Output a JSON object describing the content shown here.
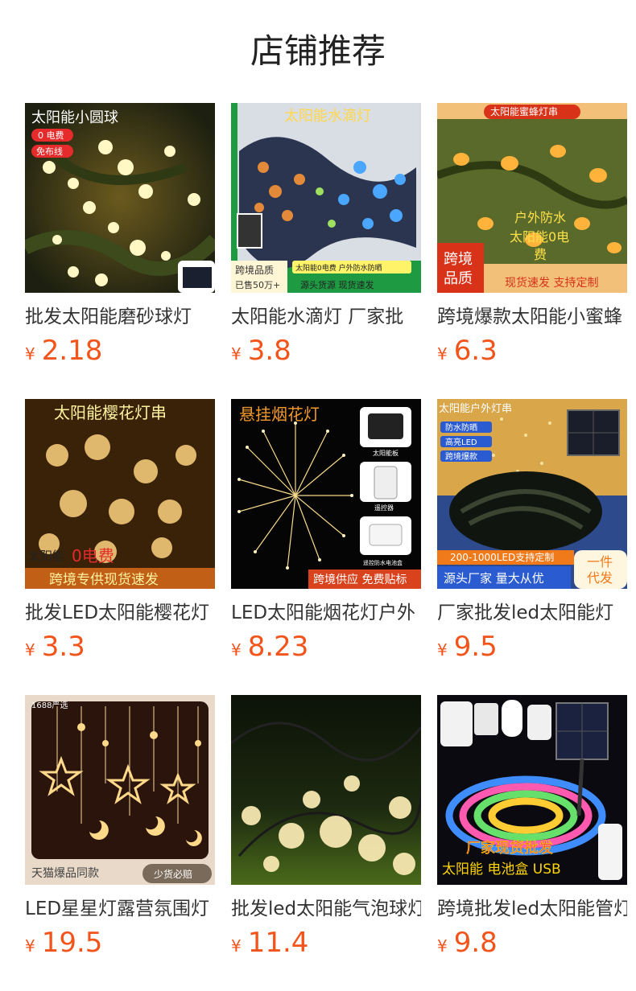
{
  "section": {
    "title": "店铺推荐"
  },
  "currency": "¥",
  "products": [
    {
      "name": "批发太阳能磨砂球灯",
      "price": "2.18",
      "image_text": {
        "headline": "太阳能小圆球",
        "tag1": "0 电费",
        "tag2": "免布线"
      }
    },
    {
      "name": "太阳能水滴灯 厂家批",
      "price": "3.8",
      "image_text": {
        "headline": "太阳能水滴灯",
        "left1": "跨境品质",
        "left2": "已售50万+",
        "right1": "太阳能0电费 户外防水防晒",
        "right2": "源头货源  现货速发"
      }
    },
    {
      "name": "跨境爆款太阳能小蜜蜂",
      "price": "6.3",
      "image_text": {
        "headline": "太阳能蜜蜂灯串",
        "mid1": "户外防水",
        "mid2": "太阳能0电",
        "mid3": "费",
        "badge": "跨境 品质",
        "bottom": "现货速发 支持定制"
      }
    },
    {
      "name": "批发LED太阳能樱花灯",
      "price": "3.3",
      "image_text": {
        "headline": "太阳能樱花灯串",
        "tag": "0电费",
        "bottom": "跨境专供现货速发"
      }
    },
    {
      "name": "LED太阳能烟花灯户外",
      "price": "8.23",
      "image_text": {
        "headline": "悬挂烟花灯",
        "c1": "太阳能板",
        "c2": "遥控器",
        "c3": "遥控防水电池盒",
        "bottom": "跨境供应 免费贴标"
      }
    },
    {
      "name": "厂家批发led太阳能灯",
      "price": "9.5",
      "image_text": {
        "headline": "太阳能户外灯串",
        "f1": "防水防晒",
        "f2": "高亮LED",
        "f3": "跨境爆款",
        "band": "200-1000LED支持定制",
        "bottom": "源头厂家 量大从优",
        "side": "一件代发"
      }
    },
    {
      "name": "LED星星灯露营氛围灯",
      "price": "19.5",
      "image_text": {
        "top": "1688严选",
        "bottom": "天猫爆品同款",
        "badge": "少货必赔"
      }
    },
    {
      "name": "批发led太阳能气泡球灯",
      "price": "11.4",
      "image_text": {}
    },
    {
      "name": "跨境批发led太阳能管灯",
      "price": "9.8",
      "image_text": {
        "headline": "厂家现货批发",
        "bottom": "太阳能 电池盒 USB"
      }
    }
  ]
}
